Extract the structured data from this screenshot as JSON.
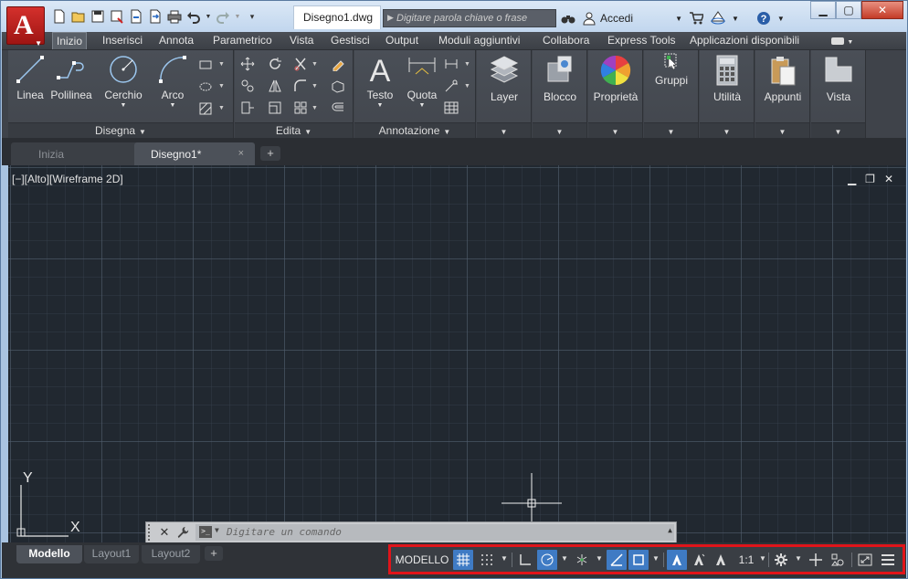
{
  "app": {
    "logo_letter": "A",
    "document_tab": "Disegno1.dwg"
  },
  "titlebar": {
    "search_placeholder": "Digitare parola chiave o frase",
    "signin_label": "Accedi",
    "help_label": "?"
  },
  "ribbon_tabs": [
    {
      "label": "Inizio",
      "active": true
    },
    {
      "label": "Inserisci"
    },
    {
      "label": "Annota"
    },
    {
      "label": "Parametrico"
    },
    {
      "label": "Vista"
    },
    {
      "label": "Gestisci"
    },
    {
      "label": "Output"
    },
    {
      "label": "Moduli aggiuntivi"
    },
    {
      "label": "Collabora"
    },
    {
      "label": "Express Tools"
    },
    {
      "label": "Applicazioni disponibili"
    }
  ],
  "panels": {
    "disegna": {
      "title": "Disegna",
      "tools": [
        "Linea",
        "Polilinea",
        "Cerchio",
        "Arco"
      ]
    },
    "edita": {
      "title": "Edita"
    },
    "annotazione": {
      "title": "Annotazione",
      "tools": [
        "Testo",
        "Quota"
      ]
    },
    "large": [
      "Layer",
      "Blocco",
      "Proprietà",
      "Gruppi",
      "Utilità",
      "Appunti",
      "Vista"
    ]
  },
  "file_tabs": {
    "start": "Inizia",
    "current": "Disegno1*",
    "close": "×",
    "add": "+"
  },
  "viewport": {
    "label": "[−][Alto][Wireframe 2D]",
    "ucs_x": "X",
    "ucs_y": "Y"
  },
  "command_line": {
    "placeholder": "Digitare un comando"
  },
  "layout_tabs": {
    "model": "Modello",
    "layout1": "Layout1",
    "layout2": "Layout2",
    "add": "+"
  },
  "statusbar": {
    "model_label": "MODELLO",
    "scale_label": "1:1"
  }
}
